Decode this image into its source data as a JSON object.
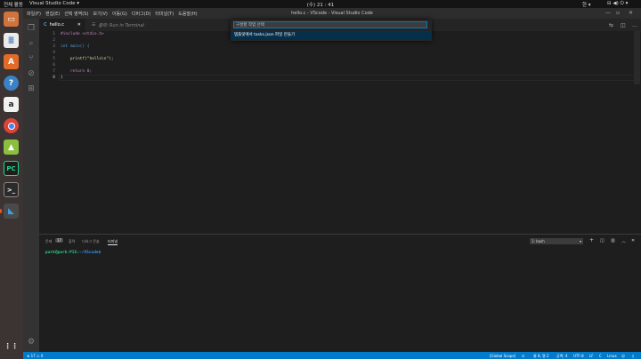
{
  "topbar": {
    "activities": "전체 활동",
    "app": "Visual Studio Code ▾",
    "clock": "(수) 21 : 41",
    "lang": "한 ▾"
  },
  "window": {
    "title": "hello.c - VScode - Visual Studio Code",
    "menu": [
      "파일(F)",
      "편집(E)",
      "선택 영역(S)",
      "보기(V)",
      "이동(G)",
      "디버그(D)",
      "터미널(T)",
      "도움말(H)"
    ]
  },
  "tabs": {
    "file_tab": "hello.c",
    "run_tab": "출력: Run in Terminal"
  },
  "editor": {
    "lines": [
      {
        "n": "1",
        "text": "#include <stdio.h>"
      },
      {
        "n": "2",
        "text": ""
      },
      {
        "n": "3",
        "text": "int main() {"
      },
      {
        "n": "4",
        "text": ""
      },
      {
        "n": "5",
        "text": "    printf(\"hello\\n\");"
      },
      {
        "n": "6",
        "text": ""
      },
      {
        "n": "7",
        "text": "    return 0;"
      },
      {
        "n": "8",
        "text": "}"
      }
    ]
  },
  "palette": {
    "placeholder": "구성할 작업 선택",
    "item": "템플릿에서 tasks.json 파일 만들기"
  },
  "panel": {
    "tabs": [
      "문제",
      "출력",
      "디버그 콘솔",
      "터미널"
    ],
    "problems_count": "17",
    "terminal_select": "1: bash",
    "prompt_user": "park@park-P15",
    "prompt_path": ":~/VScode$"
  },
  "status": {
    "problems": "⊗ 17 ⚠ 0",
    "scope": "[Global Scope]",
    "position": "줄 8, 열 2",
    "spaces": "공백: 4",
    "encoding": "UTF-8",
    "eol": "LF",
    "language": "C",
    "os": "Linux"
  }
}
